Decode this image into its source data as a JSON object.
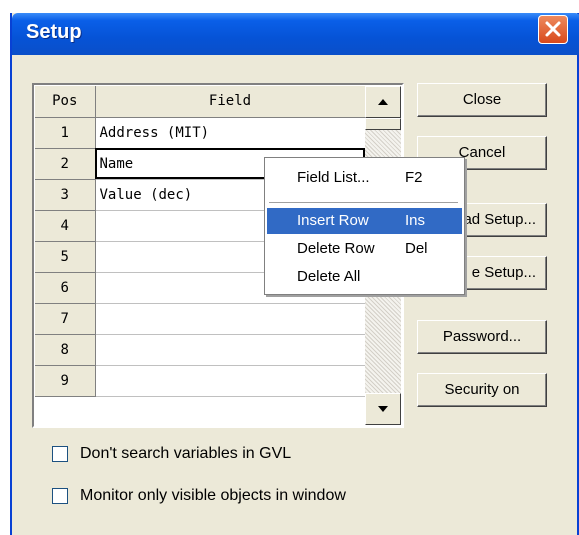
{
  "window": {
    "title": "Setup"
  },
  "grid": {
    "headers": {
      "pos": "Pos",
      "field": "Field"
    },
    "rows": [
      {
        "pos": "1",
        "field": "Address (MIT)"
      },
      {
        "pos": "2",
        "field": "Name"
      },
      {
        "pos": "3",
        "field": "Value (dec)"
      },
      {
        "pos": "4",
        "field": ""
      },
      {
        "pos": "5",
        "field": ""
      },
      {
        "pos": "6",
        "field": ""
      },
      {
        "pos": "7",
        "field": ""
      },
      {
        "pos": "8",
        "field": ""
      },
      {
        "pos": "9",
        "field": ""
      }
    ]
  },
  "buttons": {
    "close": "Close",
    "cancel": "Cancel",
    "load_setup": "ad Setup...",
    "save_setup": "e Setup...",
    "password": "Password...",
    "security": "Security on"
  },
  "checkboxes": {
    "gvl": "Don't search variables in GVL",
    "visible": "Monitor only visible objects in window"
  },
  "context_menu": {
    "field_list": {
      "label": "Field List...",
      "key": "F2"
    },
    "insert_row": {
      "label": "Insert Row",
      "key": "Ins"
    },
    "delete_row": {
      "label": "Delete Row",
      "key": "Del"
    },
    "delete_all": {
      "label": "Delete All",
      "key": ""
    }
  }
}
